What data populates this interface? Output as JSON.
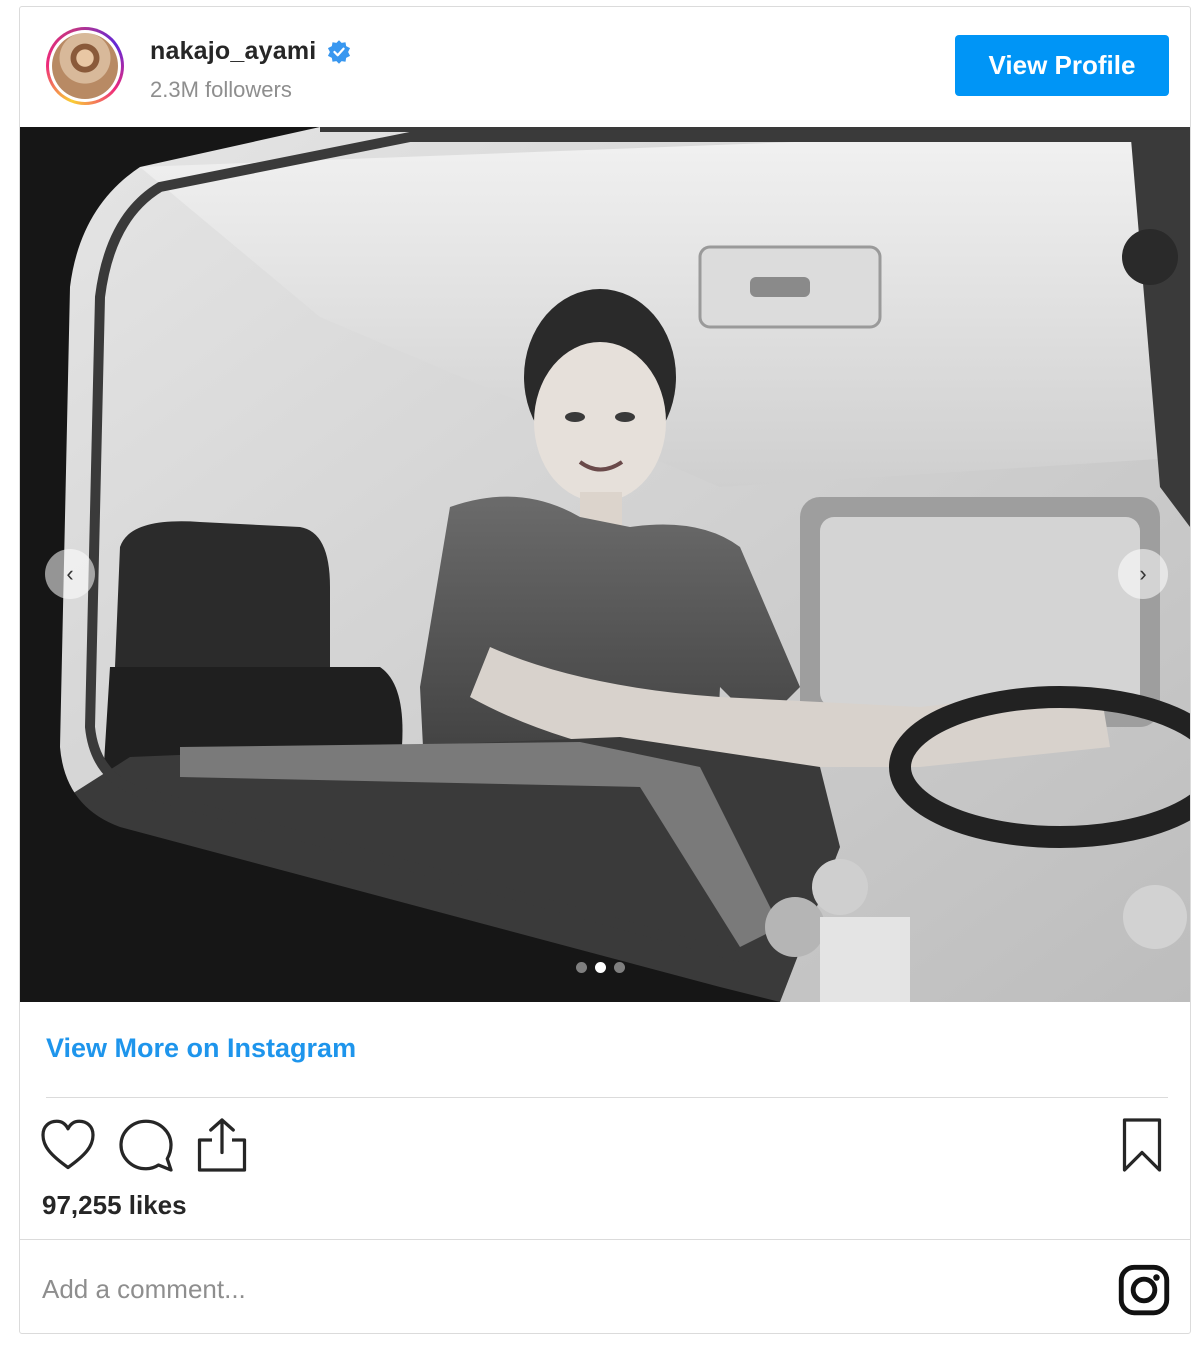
{
  "header": {
    "username": "nakajo_ayami",
    "followers": "2.3M followers",
    "view_profile_label": "View Profile",
    "verified_icon": "verified-badge-icon"
  },
  "carousel": {
    "total_slides": 3,
    "active_slide": 2,
    "prev_icon": "‹",
    "next_icon": "›"
  },
  "view_more_label": "View More on Instagram",
  "actions": {
    "like_icon": "heart-icon",
    "comment_icon": "comment-icon",
    "share_icon": "share-icon",
    "save_icon": "bookmark-icon"
  },
  "likes": "97,255 likes",
  "comment": {
    "placeholder": "Add a comment..."
  },
  "colors": {
    "accent": "#0095f6",
    "link": "#1e95ec",
    "border": "#dbdbdb",
    "muted": "#8e8e8e",
    "text": "#262626"
  }
}
